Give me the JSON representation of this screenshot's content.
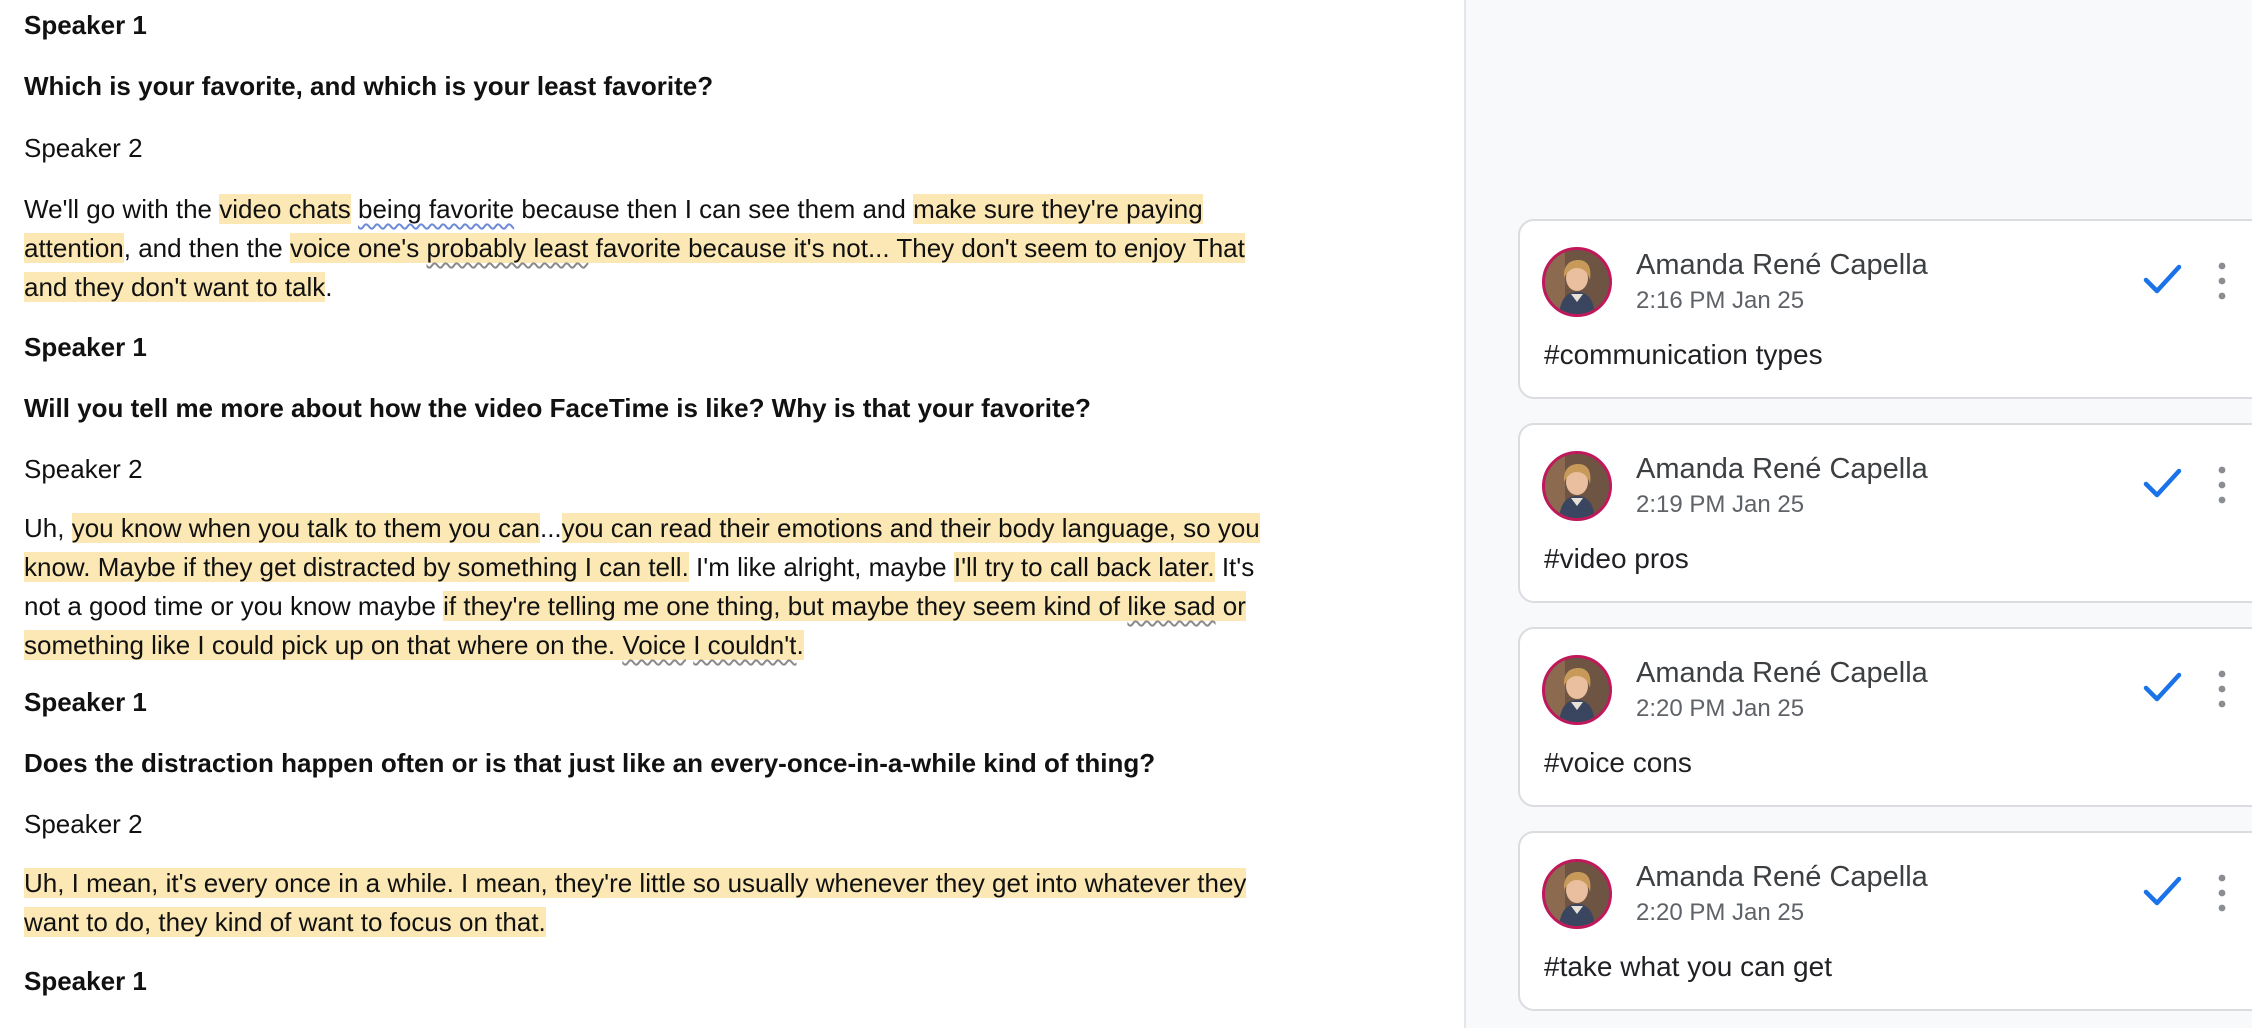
{
  "transcript": [
    {
      "style": "bold",
      "segments": [
        {
          "t": "Speaker 1"
        }
      ]
    },
    {
      "style": "bold",
      "segments": [
        {
          "t": "Which is your favorite, and which is your least favorite?"
        }
      ]
    },
    {
      "style": "normal",
      "segments": [
        {
          "t": "Speaker 2"
        }
      ]
    },
    {
      "style": "normal",
      "segments": [
        {
          "t": "We'll go with the "
        },
        {
          "t": "video chats",
          "hl": true
        },
        {
          "t": " "
        },
        {
          "t": "being favorite",
          "sq": true
        },
        {
          "t": " because then I can see them and "
        },
        {
          "t": "make sure they're paying attention",
          "hl": true
        },
        {
          "t": ", and then the "
        },
        {
          "t": "voice one's ",
          "hl": true
        },
        {
          "t": "probably least",
          "hl": true,
          "sq": "grey"
        },
        {
          "t": " favorite because it's not... They don't seem to enjoy That and they don't want to talk",
          "hl": true
        },
        {
          "t": "."
        }
      ]
    },
    {
      "style": "bold",
      "segments": [
        {
          "t": "Speaker 1"
        }
      ]
    },
    {
      "style": "bold",
      "segments": [
        {
          "t": "Will you tell me more about how the video FaceTime is like? Why is that your favorite?"
        }
      ]
    },
    {
      "style": "normal",
      "segments": [
        {
          "t": "Speaker 2"
        }
      ]
    },
    {
      "style": "normal",
      "segments": [
        {
          "t": "Uh, "
        },
        {
          "t": "you know when you talk to them you can",
          "hl": true
        },
        {
          "t": "..."
        },
        {
          "t": "you can read their emotions and their body language, so you know. Maybe if they get distracted by something I can tell.",
          "hl": true
        },
        {
          "t": " I'm like alright, maybe "
        },
        {
          "t": "I'll try to call back later.",
          "hl": true
        },
        {
          "t": " It's not a good time or you know maybe "
        },
        {
          "t": "if they're telling me one thing, but maybe they seem kind of ",
          "hl": true
        },
        {
          "t": "like sad",
          "hl": true,
          "sq": "grey"
        },
        {
          "t": " or something like I could pick up on that where on the. ",
          "hl": true
        },
        {
          "t": "Voice",
          "hl": true,
          "sq": "grey"
        },
        {
          "t": " ",
          "hl": true
        },
        {
          "t": "I couldn't",
          "hl": true,
          "sq": "grey"
        },
        {
          "t": ".",
          "hl": true
        }
      ]
    },
    {
      "style": "bold",
      "segments": [
        {
          "t": "Speaker 1"
        }
      ]
    },
    {
      "style": "bold",
      "segments": [
        {
          "t": "Does the distraction happen often or is that just like an every-once-in-a-while kind of thing?"
        }
      ]
    },
    {
      "style": "normal",
      "segments": [
        {
          "t": "Speaker 2"
        }
      ]
    },
    {
      "style": "normal",
      "segments": [
        {
          "t": "Uh, I mean, it's every once in a while. I mean, they're little so usually whenever they get into whatever they want to do, they kind of want to focus on that.",
          "hl": true
        }
      ]
    },
    {
      "style": "bold",
      "segments": [
        {
          "t": "Speaker 1"
        }
      ]
    }
  ],
  "comments": [
    {
      "author": "Amanda René Capella",
      "time": "2:16 PM Jan 25",
      "text": "#communication types"
    },
    {
      "author": "Amanda René Capella",
      "time": "2:19 PM Jan 25",
      "text": "#video pros"
    },
    {
      "author": "Amanda René Capella",
      "time": "2:20 PM Jan 25",
      "text": "#voice cons"
    },
    {
      "author": "Amanda René Capella",
      "time": "2:20 PM Jan 25",
      "text": "#take what you can get"
    }
  ],
  "colors": {
    "highlight": "#fbe8b4",
    "resolve_check": "#1a73e8",
    "avatar_ring": "#c0185b",
    "pane_background": "#f8f9fa"
  },
  "icons": {
    "resolve": "checkmark-icon",
    "more": "more-vert-icon",
    "avatar": "user-avatar"
  }
}
